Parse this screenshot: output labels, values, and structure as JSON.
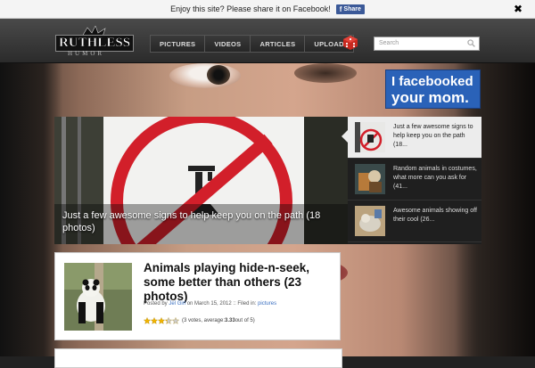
{
  "sharebar": {
    "text": "Enjoy this site? Please share it on Facebook!",
    "share_label": "Share",
    "close": "✖"
  },
  "header": {
    "logo_top": "RUTHLESS",
    "logo_bottom": "HUMOR",
    "nav": [
      "PICTURES",
      "VIDEOS",
      "ARTICLES",
      "UPLOAD"
    ],
    "search_placeholder": "Search"
  },
  "ad": {
    "line1": "I facebooked",
    "line2": "your mom."
  },
  "featured": {
    "title": "Just a few awesome signs to help keep you on the path (18 photos)",
    "items": [
      {
        "text": "Just a few awesome signs to help keep you on the path (18..."
      },
      {
        "text": "Random animals in costumes, what more can you ask for (41..."
      },
      {
        "text": "Awesome animals showing off their cool (26..."
      }
    ]
  },
  "post": {
    "title": "Animals playing hide-n-seek, some better than others (23 photos)",
    "posted_by_prefix": "Posted by ",
    "author": "Jel Girl",
    "date_text": " on March 15, 2012 :: Filed in: ",
    "category": "pictures",
    "rating_text_before": "(3 votes, average: ",
    "rating_avg": "3.33",
    "rating_text_after": " out of 5)",
    "rating_value": 3.33
  },
  "colors": {
    "brand_blue": "#2a62b8",
    "facebook": "#3b5998",
    "link": "#3a6fc0"
  }
}
